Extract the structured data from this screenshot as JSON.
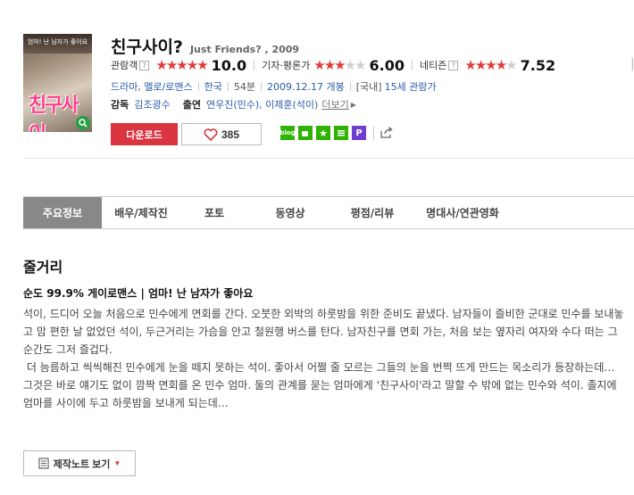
{
  "movie": {
    "title_ko": "친구사이?",
    "title_en": "Just Friends? , 2009",
    "poster_text": "엄마! 난 남자가 좋아요",
    "poster_title": "친구사이"
  },
  "ratings": [
    {
      "label": "관람객",
      "help": "?",
      "stars_on": 5,
      "stars_total": 5,
      "score": "10.0"
    },
    {
      "label": "기자·평론가",
      "help": "",
      "stars_on": 3,
      "stars_total": 5,
      "score": "6.00"
    },
    {
      "label": "네티즌",
      "help": "?",
      "stars_on": 4,
      "stars_total": 5,
      "score": "7.52"
    }
  ],
  "meta": {
    "genre": "드라마, 멜로/로맨스",
    "country": "한국",
    "runtime": "54분",
    "release": "2009.12.17 개봉",
    "rating_prefix": "[국내]",
    "rating": "15세 관람가"
  },
  "people": {
    "director_label": "감독",
    "director": "김조광수",
    "cast_label": "출연",
    "cast": "연우진(민수), 이제훈(석이)",
    "more": "더보기"
  },
  "actions": {
    "download": "다운로드",
    "likes": "385"
  },
  "share_icons": [
    "blog-icon",
    "cafe-icon",
    "star-icon",
    "band-icon",
    "post-icon"
  ],
  "tabs": [
    {
      "label": "주요정보",
      "active": true
    },
    {
      "label": "배우/제작진",
      "active": false
    },
    {
      "label": "포토",
      "active": false
    },
    {
      "label": "동영상",
      "active": false
    },
    {
      "label": "평점/리뷰",
      "active": false
    },
    {
      "label": "명대사/연관영화",
      "active": false
    }
  ],
  "story": {
    "heading": "줄거리",
    "tagline": "순도 99.9% 게이로맨스 | 엄마! 난 남자가 좋아요",
    "p1": "석이, 드디어 오늘 처음으로 민수에게 면회를 간다. 오붓한 외박의 하룻밤을 위한 준비도 끝냈다. 남자들이 즐비한 군대로 민수를 보내놓고 맘 편한 날 없었던 석이, 두근거리는 가슴을 안고 철원행 버스를 탄다. 남자친구를 면회 가는, 처음 보는 옆자리 여자와 수다 떠는 그 순간도 그저 즐겁다.",
    "p2": " 더 늠름하고 씩씩해진 민수에게 눈을 떼지 못하는 석이. 좋아서 어쩔 줄 모르는 그들의 눈을 번쩍 뜨게 만드는 목소리가 등장하는데… 그것은 바로 얘기도 없이 깜짝 면회를 온 민수 엄마. 둘의 관계를 묻는 엄마에게 '친구사이'라고 말할 수 밖에 없는 민수와 석이. 졸지에 엄마를 사이에 두고 하룻밤을 보내게 되는데…",
    "notes_button": "제작노트 보기"
  },
  "colors": {
    "accent": "#d9343f",
    "link": "#2b5ba8",
    "star_on": "#e23a3a",
    "star_off": "#cfcfcf",
    "tab_active": "#888888"
  }
}
